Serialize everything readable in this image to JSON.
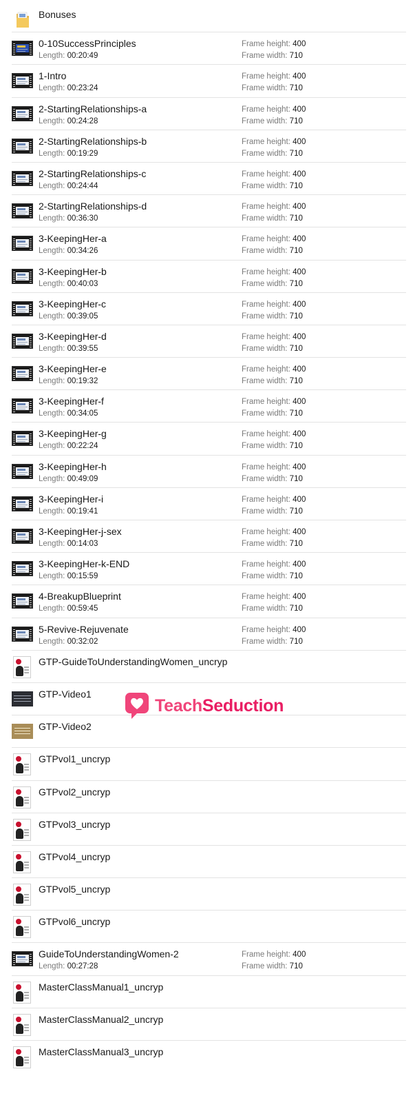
{
  "labels": {
    "length": "Length:",
    "frame_height": "Frame height:",
    "frame_width": "Frame width:"
  },
  "watermark": {
    "part1": "Teach",
    "part2": "Seduction"
  },
  "items": [
    {
      "name": "Bonuses",
      "type": "folder"
    },
    {
      "name": "0-10SuccessPrinciples",
      "type": "video",
      "thumb": "blue",
      "length": "00:20:49",
      "height": "400",
      "width": "710"
    },
    {
      "name": "1-Intro",
      "type": "video",
      "length": "00:23:24",
      "height": "400",
      "width": "710"
    },
    {
      "name": "2-StartingRelationships-a",
      "type": "video",
      "length": "00:24:28",
      "height": "400",
      "width": "710"
    },
    {
      "name": "2-StartingRelationships-b",
      "type": "video",
      "length": "00:19:29",
      "height": "400",
      "width": "710"
    },
    {
      "name": "2-StartingRelationships-c",
      "type": "video",
      "length": "00:24:44",
      "height": "400",
      "width": "710"
    },
    {
      "name": "2-StartingRelationships-d",
      "type": "video",
      "length": "00:36:30",
      "height": "400",
      "width": "710"
    },
    {
      "name": "3-KeepingHer-a",
      "type": "video",
      "length": "00:34:26",
      "height": "400",
      "width": "710"
    },
    {
      "name": "3-KeepingHer-b",
      "type": "video",
      "length": "00:40:03",
      "height": "400",
      "width": "710"
    },
    {
      "name": "3-KeepingHer-c",
      "type": "video",
      "length": "00:39:05",
      "height": "400",
      "width": "710"
    },
    {
      "name": "3-KeepingHer-d",
      "type": "video",
      "length": "00:39:55",
      "height": "400",
      "width": "710"
    },
    {
      "name": "3-KeepingHer-e",
      "type": "video",
      "length": "00:19:32",
      "height": "400",
      "width": "710"
    },
    {
      "name": "3-KeepingHer-f",
      "type": "video",
      "length": "00:34:05",
      "height": "400",
      "width": "710"
    },
    {
      "name": "3-KeepingHer-g",
      "type": "video",
      "length": "00:22:24",
      "height": "400",
      "width": "710"
    },
    {
      "name": "3-KeepingHer-h",
      "type": "video",
      "length": "00:49:09",
      "height": "400",
      "width": "710"
    },
    {
      "name": "3-KeepingHer-i",
      "type": "video",
      "length": "00:19:41",
      "height": "400",
      "width": "710"
    },
    {
      "name": "3-KeepingHer-j-sex",
      "type": "video",
      "length": "00:14:03",
      "height": "400",
      "width": "710"
    },
    {
      "name": "3-KeepingHer-k-END",
      "type": "video",
      "length": "00:15:59",
      "height": "400",
      "width": "710"
    },
    {
      "name": "4-BreakupBlueprint",
      "type": "video",
      "length": "00:59:45",
      "height": "400",
      "width": "710"
    },
    {
      "name": "5-Revive-Rejuvenate",
      "type": "video",
      "length": "00:32:02",
      "height": "400",
      "width": "710"
    },
    {
      "name": "GTP-GuideToUnderstandingWomen_uncryp",
      "type": "doc"
    },
    {
      "name": "GTP-Video1",
      "type": "image",
      "thumb": "dark"
    },
    {
      "name": "GTP-Video2",
      "type": "image",
      "thumb": "gold"
    },
    {
      "name": "GTPvol1_uncryp",
      "type": "doc"
    },
    {
      "name": "GTPvol2_uncryp",
      "type": "doc"
    },
    {
      "name": "GTPvol3_uncryp",
      "type": "doc"
    },
    {
      "name": "GTPvol4_uncryp",
      "type": "doc"
    },
    {
      "name": "GTPvol5_uncryp",
      "type": "doc"
    },
    {
      "name": "GTPvol6_uncryp",
      "type": "doc"
    },
    {
      "name": "GuideToUnderstandingWomen-2",
      "type": "video",
      "length": "00:27:28",
      "height": "400",
      "width": "710"
    },
    {
      "name": "MasterClassManual1_uncryp",
      "type": "doc"
    },
    {
      "name": "MasterClassManual2_uncryp",
      "type": "doc"
    },
    {
      "name": "MasterClassManual3_uncryp",
      "type": "doc"
    }
  ]
}
